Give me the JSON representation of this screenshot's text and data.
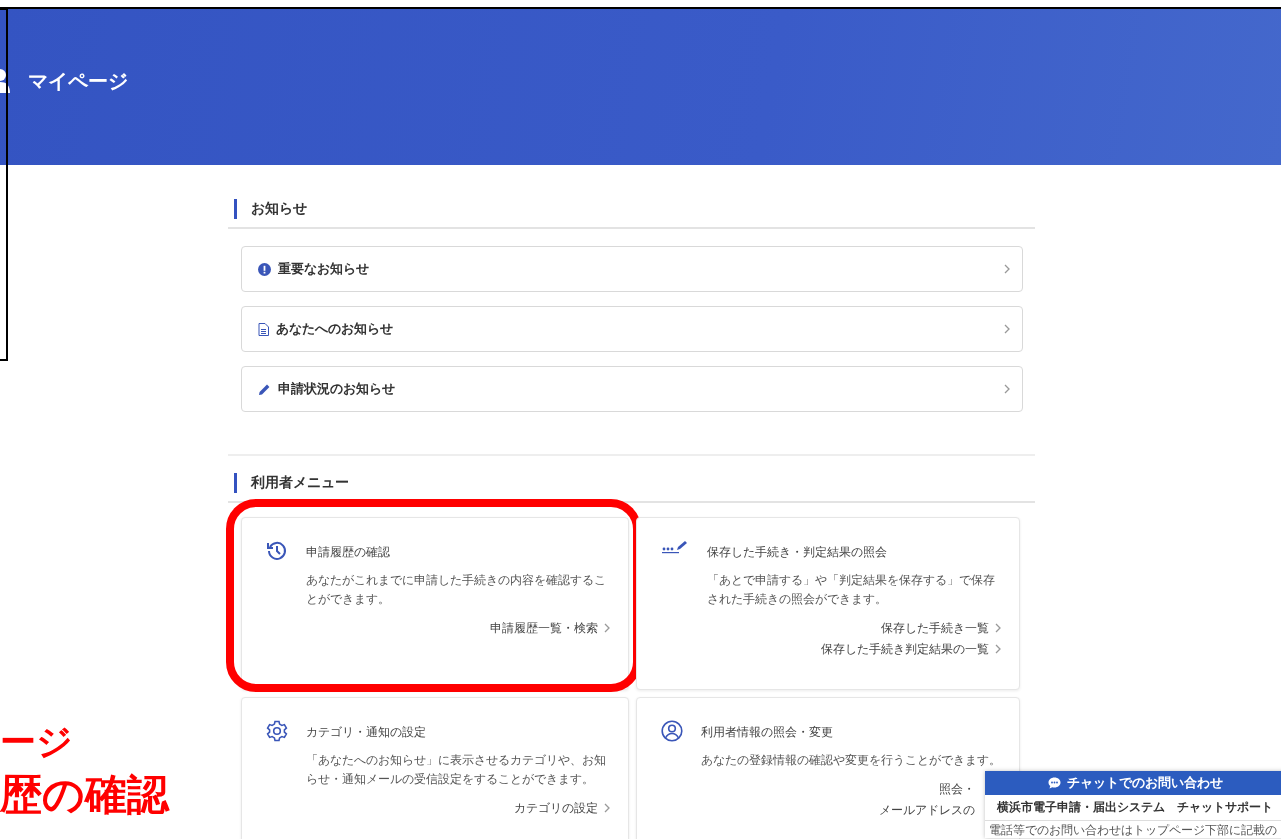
{
  "header": {
    "title": "マイページ"
  },
  "notices": {
    "heading": "お知らせ",
    "items": [
      {
        "kind": "important",
        "label": "重要なお知らせ"
      },
      {
        "kind": "document",
        "label": "あなたへのお知らせ"
      },
      {
        "kind": "status",
        "label": "申請状況のお知らせ"
      }
    ]
  },
  "menu": {
    "heading": "利用者メニュー",
    "cards": [
      {
        "kind": "history",
        "highlighted": true,
        "title": "申請履歴の確認",
        "description": "あなたがこれまでに申請した手続きの内容を確認することができます。",
        "links": [
          "申請履歴一覧・検索"
        ]
      },
      {
        "kind": "saved",
        "highlighted": false,
        "title": "保存した手続き・判定結果の照会",
        "description": "「あとで申請する」や「判定結果を保存する」で保存された手続きの照会ができます。",
        "links": [
          "保存した手続き一覧",
          "保存した手続き判定結果の一覧"
        ]
      },
      {
        "kind": "settings",
        "highlighted": false,
        "title": "カテゴリ・通知の設定",
        "description": "「あなたへのお知らせ」に表示させるカテゴリや、お知らせ・通知メールの受信設定をすることができます。",
        "links": [
          "カテゴリの設定"
        ]
      },
      {
        "kind": "profile",
        "highlighted": false,
        "title": "利用者情報の照会・変更",
        "description": "あなたの登録情報の確認や変更を行うことができます。",
        "links": [
          "照会・",
          "メールアドレスの"
        ],
        "links_cut": true
      }
    ]
  },
  "annotation_texts": [
    "ージ",
    "歴の確認"
  ],
  "chat_widget": {
    "title": "チャットでのお問い合わせ",
    "subtitle": "横浜市電子申請・届出システム　チャットサポート",
    "note": "電話等でのお問い合わせはトップページ下部に記載の"
  }
}
